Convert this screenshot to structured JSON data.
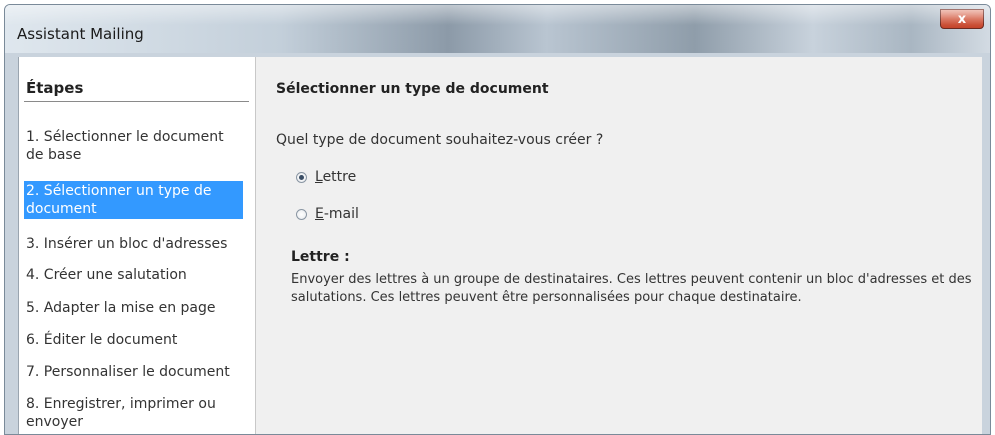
{
  "window": {
    "title": "Assistant Mailing",
    "close_label": "x"
  },
  "sidebar": {
    "heading": "Étapes",
    "items": [
      {
        "label": "1. Sélectionner le document de base",
        "active": false
      },
      {
        "label": "2. Sélectionner un type de document",
        "active": true
      },
      {
        "label": "3. Insérer un bloc d'adresses",
        "active": false
      },
      {
        "label": "4. Créer une salutation",
        "active": false
      },
      {
        "label": "5. Adapter la mise en page",
        "active": false
      },
      {
        "label": "6. Éditer le document",
        "active": false
      },
      {
        "label": "7. Personnaliser le document",
        "active": false
      },
      {
        "label": "8. Enregistrer, imprimer ou envoyer",
        "active": false
      }
    ]
  },
  "main": {
    "title": "Sélectionner un type de document",
    "question": "Quel type de document souhaitez-vous créer ?",
    "options": [
      {
        "label": "Lettre",
        "checked": true
      },
      {
        "label": "E-mail",
        "checked": false
      }
    ],
    "description_title": "Lettre :",
    "description": "Envoyer des lettres à un groupe de destinataires. Ces lettres peuvent contenir un bloc d'adresses et des salutations. Ces lettres peuvent être personnalisées pour chaque destinataire."
  },
  "colors": {
    "selection": "#3399ff",
    "close_button": "#c4442b"
  }
}
